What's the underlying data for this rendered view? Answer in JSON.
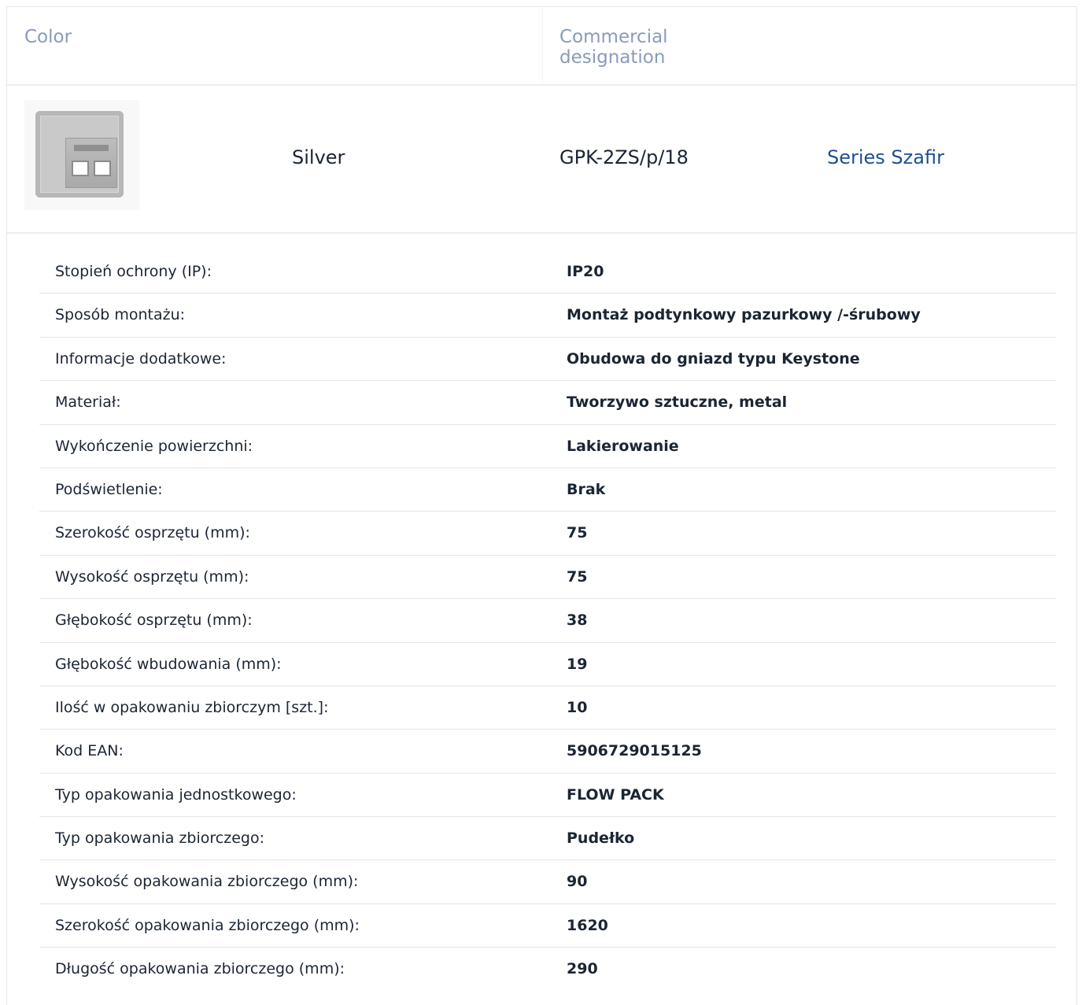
{
  "header": {
    "color_label": "Color",
    "commercial_label": "Commercial designation"
  },
  "product": {
    "image_icon": "socket-keystone-icon",
    "color": "Silver",
    "code": "GPK-2ZS/p/18",
    "series": "Series Szafir",
    "series_color": "#1f4f8f"
  },
  "specs": [
    {
      "label": "Stopień ochrony (IP):",
      "value": "IP20"
    },
    {
      "label": "Sposób montażu:",
      "value": "Montaż podtynkowy pazurkowy /-śrubowy"
    },
    {
      "label": "Informacje dodatkowe:",
      "value": "Obudowa do gniazd typu Keystone"
    },
    {
      "label": "Materiał:",
      "value": "Tworzywo sztuczne, metal"
    },
    {
      "label": "Wykończenie powierzchni:",
      "value": "Lakierowanie"
    },
    {
      "label": "Podświetlenie:",
      "value": "Brak"
    },
    {
      "label": "Szerokość osprzętu (mm):",
      "value": "75"
    },
    {
      "label": "Wysokość osprzętu (mm):",
      "value": "75"
    },
    {
      "label": "Głębokość osprzętu (mm):",
      "value": "38"
    },
    {
      "label": "Głębokość wbudowania (mm):",
      "value": "19"
    },
    {
      "label": "Ilość w opakowaniu zbiorczym [szt.]:",
      "value": "10"
    },
    {
      "label": "Kod EAN:",
      "value": "5906729015125"
    },
    {
      "label": "Typ opakowania jednostkowego:",
      "value": "FLOW PACK"
    },
    {
      "label": "Typ opakowania zbiorczego:",
      "value": "Pudełko"
    },
    {
      "label": "Wysokość opakowania zbiorczego (mm):",
      "value": "90"
    },
    {
      "label": "Szerokość opakowania zbiorczego (mm):",
      "value": "1620"
    },
    {
      "label": "Długość opakowania zbiorczego (mm):",
      "value": "290"
    }
  ]
}
